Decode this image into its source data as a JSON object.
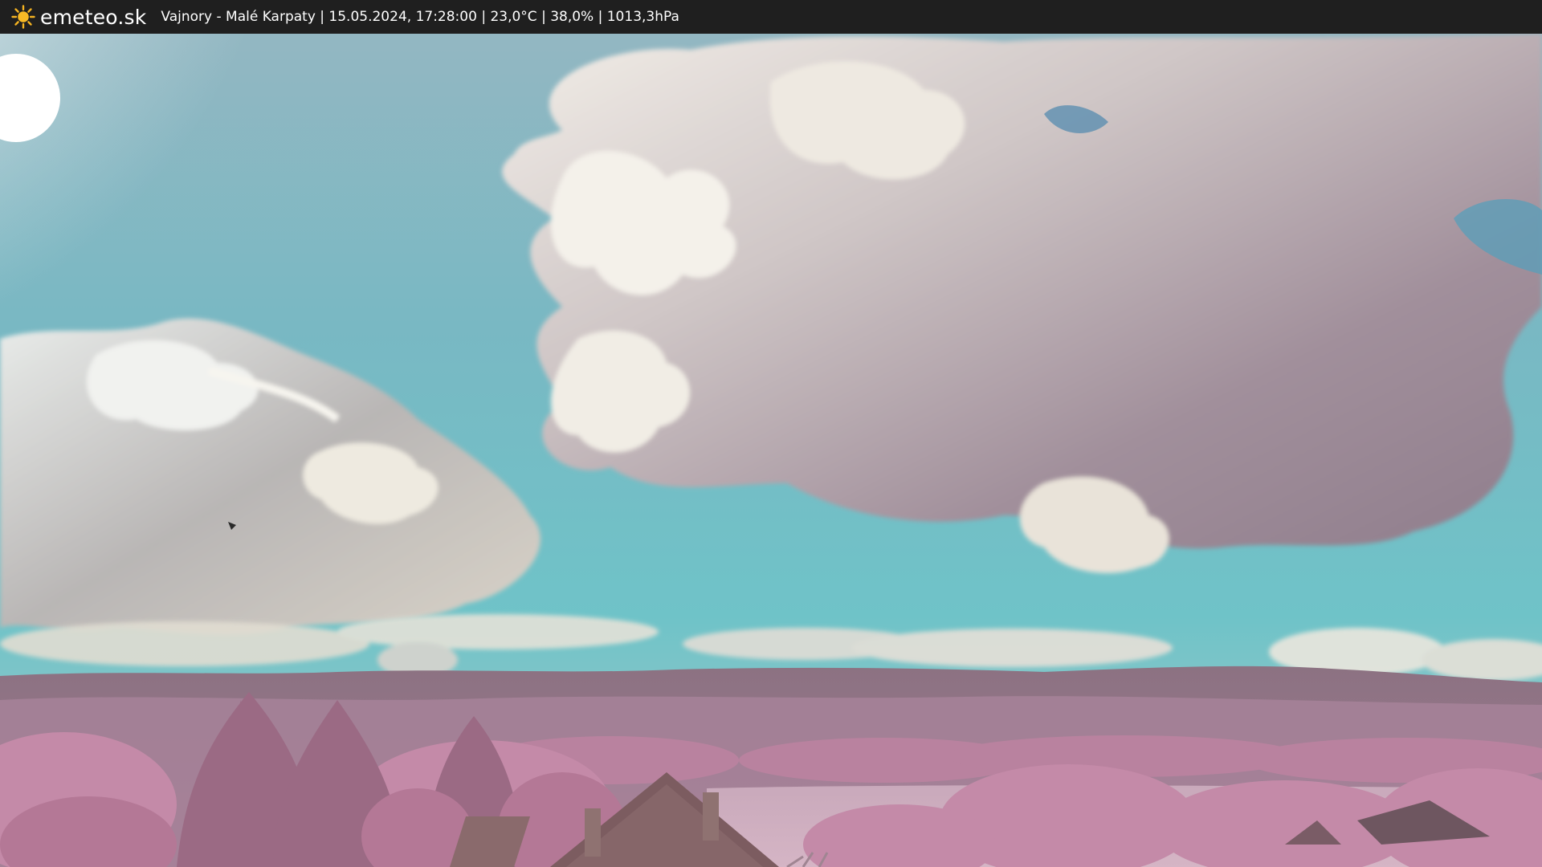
{
  "header": {
    "brand": "emeteo.sk",
    "logo_icon": "sun-icon",
    "info": "Vajnory - Malé Karpaty | 15.05.2024, 17:28:00 | 23,0°C | 38,0% | 1013,3hPa"
  },
  "camera": {
    "view": "infrared webcam view: sun, sky with cumulus clouds, Malé Karpaty hills, pink-toned trees and rooftops"
  },
  "colors": {
    "bar": "#1f1f1f",
    "sky_top": "#8fb9c4",
    "sky_low": "#6cc2c8",
    "foliage": "#c48aa8",
    "hills": "#8b6f82"
  }
}
